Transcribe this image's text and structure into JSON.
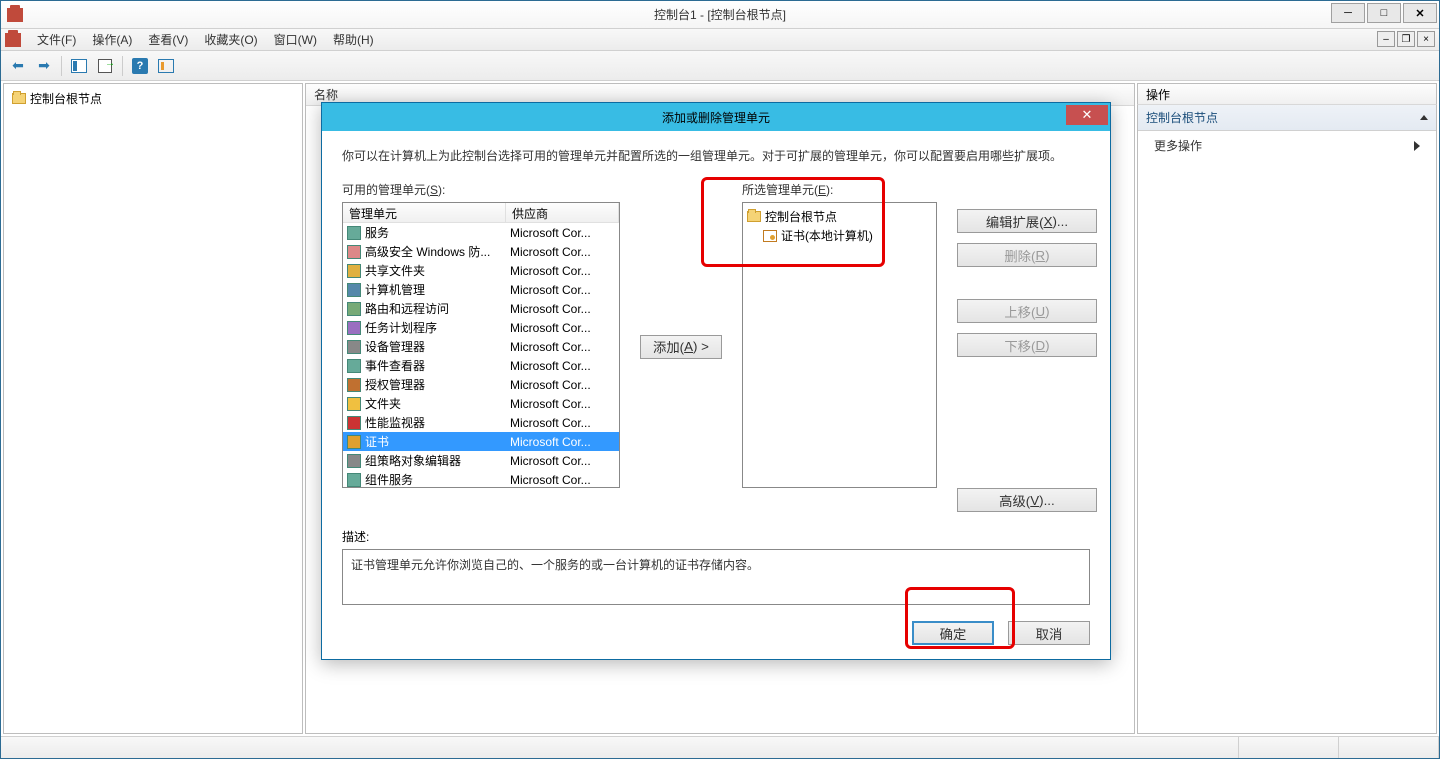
{
  "window": {
    "title": "控制台1 - [控制台根节点]"
  },
  "menu": {
    "file": "文件(F)",
    "action": "操作(A)",
    "view": "查看(V)",
    "favorites": "收藏夹(O)",
    "window": "窗口(W)",
    "help": "帮助(H)"
  },
  "leftPane": {
    "root": "控制台根节点"
  },
  "centerPane": {
    "header_name": "名称"
  },
  "rightPane": {
    "header": "操作",
    "section": "控制台根节点",
    "more": "更多操作"
  },
  "dialog": {
    "title": "添加或删除管理单元",
    "intro": "你可以在计算机上为此控制台选择可用的管理单元并配置所选的一组管理单元。对于可扩展的管理单元，你可以配置要启用哪些扩展项。",
    "available_label_pre": "可用的管理单元(",
    "available_label_u": "S",
    "available_label_post": "):",
    "col_unit": "管理单元",
    "col_vendor": "供应商",
    "selected_label_pre": "所选管理单元(",
    "selected_label_u": "E",
    "selected_label_post": "):",
    "add_btn_pre": "添加(",
    "add_btn_u": "A",
    "add_btn_post": ") >",
    "edit_ext_pre": "编辑扩展(",
    "edit_ext_u": "X",
    "edit_ext_post": ")...",
    "remove_pre": "删除(",
    "remove_u": "R",
    "remove_post": ")",
    "up_pre": "上移(",
    "up_u": "U",
    "up_post": ")",
    "down_pre": "下移(",
    "down_u": "D",
    "down_post": ")",
    "advanced_pre": "高级(",
    "advanced_u": "V",
    "advanced_post": ")...",
    "desc_label": "描述:",
    "desc_text": "证书管理单元允许你浏览自己的、一个服务的或一台计算机的证书存储内容。",
    "ok": "确定",
    "cancel": "取消",
    "selected_tree": {
      "root": "控制台根节点",
      "child": "证书(本地计算机)"
    },
    "snapins": [
      {
        "name": "服务",
        "vendor": "Microsoft Cor..."
      },
      {
        "name": "高级安全 Windows 防...",
        "vendor": "Microsoft Cor..."
      },
      {
        "name": "共享文件夹",
        "vendor": "Microsoft Cor..."
      },
      {
        "name": "计算机管理",
        "vendor": "Microsoft Cor..."
      },
      {
        "name": "路由和远程访问",
        "vendor": "Microsoft Cor..."
      },
      {
        "name": "任务计划程序",
        "vendor": "Microsoft Cor..."
      },
      {
        "name": "设备管理器",
        "vendor": "Microsoft Cor..."
      },
      {
        "name": "事件查看器",
        "vendor": "Microsoft Cor..."
      },
      {
        "name": "授权管理器",
        "vendor": "Microsoft Cor..."
      },
      {
        "name": "文件夹",
        "vendor": "Microsoft Cor..."
      },
      {
        "name": "性能监视器",
        "vendor": "Microsoft Cor..."
      },
      {
        "name": "证书",
        "vendor": "Microsoft Cor...",
        "selected": true
      },
      {
        "name": "组策略对象编辑器",
        "vendor": "Microsoft Cor..."
      },
      {
        "name": "组件服务",
        "vendor": "Microsoft Cor..."
      }
    ]
  }
}
